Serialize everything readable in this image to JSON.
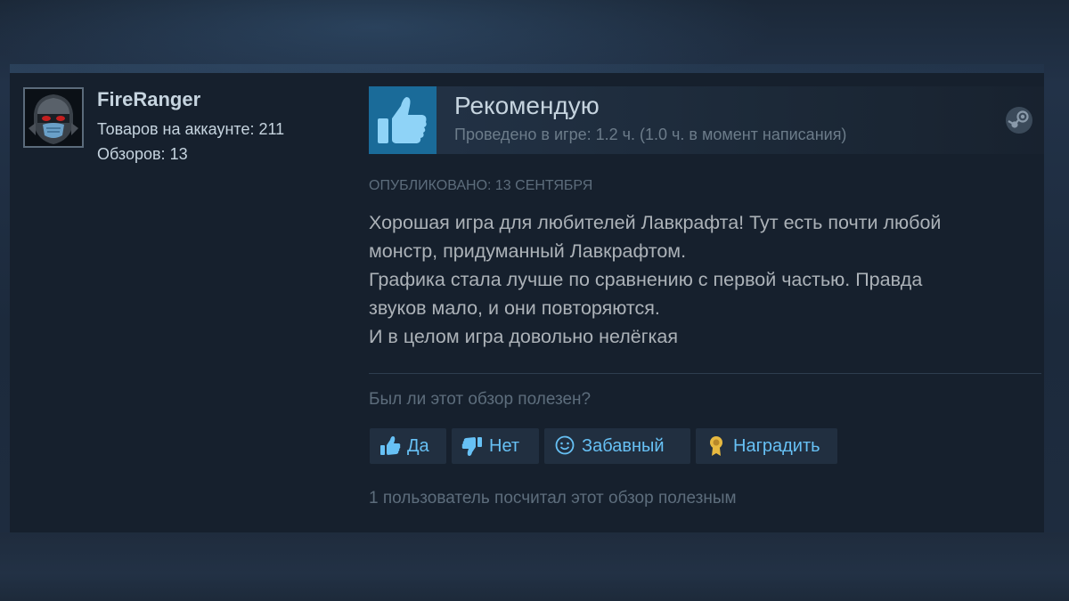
{
  "author": {
    "name": "FireRanger",
    "products": "Товаров на аккаунте: 211",
    "reviews": "Обзоров: 13"
  },
  "recommendation": {
    "label": "Рекомендую",
    "hours": "Проведено в игре: 1.2 ч. (1.0 ч. в момент написания)",
    "icon": "thumbs-up-icon"
  },
  "review": {
    "posted": "Опубликовано: 13 сентября",
    "lines": [
      "Хорошая игра для любителей Лавкрафта! Тут есть почти любой",
      "монстр, придуманный Лавкрафтом.",
      "Графика стала лучше по сравнению с первой частью. Правда",
      "звуков мало, и они повторяются.",
      "И в целом игра довольно нелёгкая"
    ]
  },
  "helpful": {
    "question": "Был ли этот обзор полезен?",
    "buttons": {
      "yes": "Да",
      "no": "Нет",
      "funny": "Забавный",
      "award": "Наградить"
    },
    "count_text": "1 пользователь посчитал этот обзор полезным"
  },
  "colors": {
    "accent": "#67c1f5",
    "thumb_box": "#1a6b99",
    "award": "#e7b940"
  }
}
